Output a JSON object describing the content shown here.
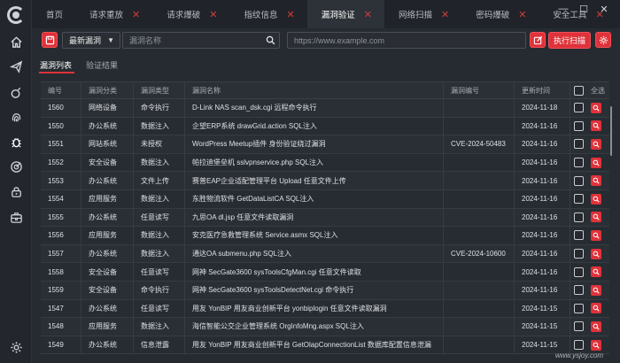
{
  "tabs": [
    {
      "label": "首页",
      "closable": false,
      "active": false
    },
    {
      "label": "请求重放",
      "closable": true,
      "active": false
    },
    {
      "label": "请求爆破",
      "closable": true,
      "active": false
    },
    {
      "label": "指纹信息",
      "closable": true,
      "active": false
    },
    {
      "label": "漏洞验证",
      "closable": true,
      "active": true
    },
    {
      "label": "网络扫描",
      "closable": true,
      "active": false
    },
    {
      "label": "密码爆破",
      "closable": true,
      "active": false
    },
    {
      "label": "安全工具",
      "closable": true,
      "active": false
    }
  ],
  "close_glyph": "✕",
  "window_controls": {
    "minimize": "—",
    "maximize": "☐",
    "close": "✕"
  },
  "toolbar": {
    "select_value": "最新漏洞",
    "search_placeholder": "漏洞名称",
    "url_placeholder": "https://www.example.com",
    "scan_label": "执行扫描"
  },
  "subtabs": {
    "list": "漏洞列表",
    "results": "验证结果"
  },
  "table": {
    "headers": {
      "id": "编号",
      "category": "漏洞分类",
      "type": "漏洞类型",
      "name": "漏洞名称",
      "cve": "漏洞编号",
      "date": "更新时间",
      "select_all": "全选"
    },
    "rows": [
      {
        "id": "1560",
        "category": "网络设备",
        "type": "命令执行",
        "name": "D-Link NAS scan_dsk.cgi 远程命令执行",
        "cve": "",
        "date": "2024-11-18"
      },
      {
        "id": "1550",
        "category": "办公系统",
        "type": "数据注入",
        "name": "企望ERP系统 drawGrid.action SQL注入",
        "cve": "",
        "date": "2024-11-16"
      },
      {
        "id": "1551",
        "category": "网站系统",
        "type": "未授权",
        "name": "WordPress Meetup插件 身份验证绕过漏洞",
        "cve": "CVE-2024-50483",
        "date": "2024-11-16"
      },
      {
        "id": "1552",
        "category": "安全设备",
        "type": "数据注入",
        "name": "帕拉迪堡垒机 sslvpnservice.php SQL注入",
        "cve": "",
        "date": "2024-11-16"
      },
      {
        "id": "1553",
        "category": "办公系统",
        "type": "文件上传",
        "name": "赛普EAP企业适配管理平台 Upload 任意文件上传",
        "cve": "",
        "date": "2024-11-16"
      },
      {
        "id": "1554",
        "category": "应用服务",
        "type": "数据注入",
        "name": "东胜物流软件 GetDataListCA SQL注入",
        "cve": "",
        "date": "2024-11-16"
      },
      {
        "id": "1555",
        "category": "办公系统",
        "type": "任意读写",
        "name": "九思OA dl.jsp 任意文件读取漏洞",
        "cve": "",
        "date": "2024-11-16"
      },
      {
        "id": "1556",
        "category": "应用服务",
        "type": "数据注入",
        "name": "安克医疗急救管理系统 Service.asmx SQL注入",
        "cve": "",
        "date": "2024-11-16"
      },
      {
        "id": "1557",
        "category": "办公系统",
        "type": "数据注入",
        "name": "通达OA submenu.php SQL注入",
        "cve": "CVE-2024-10600",
        "date": "2024-11-16"
      },
      {
        "id": "1558",
        "category": "安全设备",
        "type": "任意读写",
        "name": "网神 SecGate3600 sysToolsCfgMan.cgi 任意文件读取",
        "cve": "",
        "date": "2024-11-16"
      },
      {
        "id": "1559",
        "category": "安全设备",
        "type": "命令执行",
        "name": "网神 SecGate3600 sysToolsDetectNet.cgi 命令执行",
        "cve": "",
        "date": "2024-11-16"
      },
      {
        "id": "1547",
        "category": "办公系统",
        "type": "任意读写",
        "name": "用友 YonBIP 用友商业创新平台 yonbiplogin 任意文件读取漏洞",
        "cve": "",
        "date": "2024-11-15"
      },
      {
        "id": "1548",
        "category": "应用服务",
        "type": "数据注入",
        "name": "海信智能公交企业管理系统 OrgInfoMng.aspx SQL注入",
        "cve": "",
        "date": "2024-11-15"
      },
      {
        "id": "1549",
        "category": "办公系统",
        "type": "信息泄露",
        "name": "用友 YonBIP 用友商业创新平台 GetOlapConnectionList 数据库配置信息泄漏",
        "cve": "",
        "date": "2024-11-15"
      }
    ]
  },
  "watermark": "www.ysjoy.com",
  "colors": {
    "accent": "#e0323a",
    "background": "#262b31"
  },
  "icons": [
    "home-icon",
    "send-icon",
    "bomb-icon",
    "fingerprint-icon",
    "bug-icon",
    "radar-icon",
    "lock-icon",
    "toolbox-icon",
    "settings-icon"
  ]
}
